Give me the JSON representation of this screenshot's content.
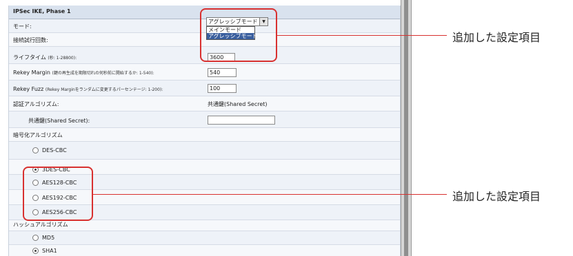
{
  "section": {
    "title": "IPSec IKE, Phase 1"
  },
  "fields": {
    "mode": {
      "label": "モード:",
      "selected": "アグレッシブモード",
      "options": [
        "メインモード",
        "アグレッシブモード"
      ]
    },
    "retry": {
      "label": "接続試行回数:"
    },
    "lifetime": {
      "label": "ライフタイム",
      "hint": "(秒: 1-28800):",
      "value": "3600"
    },
    "rekey_margin": {
      "label": "Rekey Margin",
      "hint": "(鍵の再生成を期限切れの何秒前に開始するか: 1-540):",
      "value": "540"
    },
    "rekey_fuzz": {
      "label": "Rekey Fuzz",
      "hint": "(Rekey Marginをランダムに変更するパーセンテージ: 1-200):",
      "value": "100"
    },
    "auth_algo": {
      "label": "認証アルゴリズム:",
      "value": "共通鍵(Shared Secret)"
    },
    "shared_secret": {
      "label": "共通鍵(Shared Secret):",
      "value": ""
    },
    "encryption": {
      "label": "暗号化アルゴリズム",
      "options": [
        "DES-CBC",
        "3DES-CBC",
        "AES128-CBC",
        "AES192-CBC",
        "AES256-CBC"
      ],
      "selected": "3DES-CBC"
    },
    "hash": {
      "label": "ハッシュアルゴリズム",
      "options": [
        "MD5",
        "SHA1"
      ],
      "selected": "SHA1"
    }
  },
  "callouts": [
    {
      "text": "追加した設定項目"
    },
    {
      "text": "追加した設定項目"
    }
  ],
  "colors": {
    "accent": "#d8302f",
    "header": "#d9e2ee",
    "panel": "#eef2f8"
  }
}
